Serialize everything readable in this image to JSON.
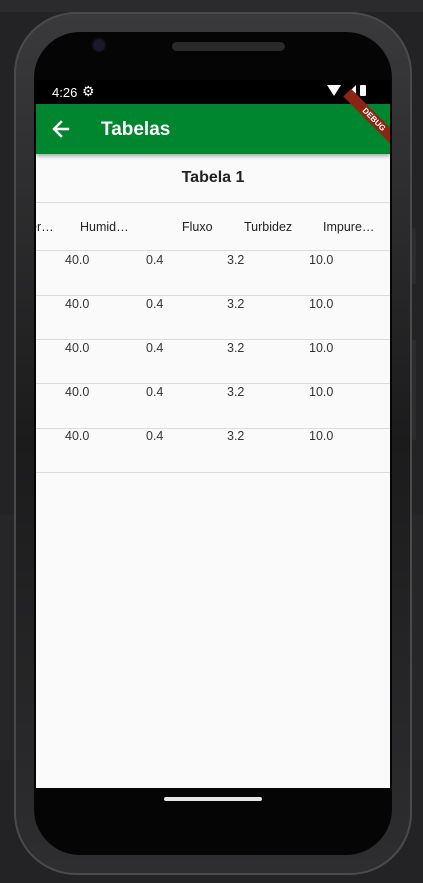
{
  "status_bar": {
    "time": "4:26",
    "gear_glyph": "⚙",
    "icons": [
      "wifi-icon",
      "signal-icon",
      "battery-icon"
    ]
  },
  "appbar": {
    "title": "Tabelas",
    "back_icon": "arrow-left-icon",
    "color": "#00862f"
  },
  "debug_banner": "DEBUG",
  "table": {
    "title": "Tabela 1",
    "headers": [
      "er…",
      "Humid…",
      "Fluxo",
      "Turbidez",
      "Impure…"
    ],
    "rows": [
      [
        "40.0",
        "0.4",
        "3.2",
        "10.0"
      ],
      [
        "40.0",
        "0.4",
        "3.2",
        "10.0"
      ],
      [
        "40.0",
        "0.4",
        "3.2",
        "10.0"
      ],
      [
        "40.0",
        "0.4",
        "3.2",
        "10.0"
      ],
      [
        "40.0",
        "0.4",
        "3.2",
        "10.0"
      ]
    ]
  }
}
